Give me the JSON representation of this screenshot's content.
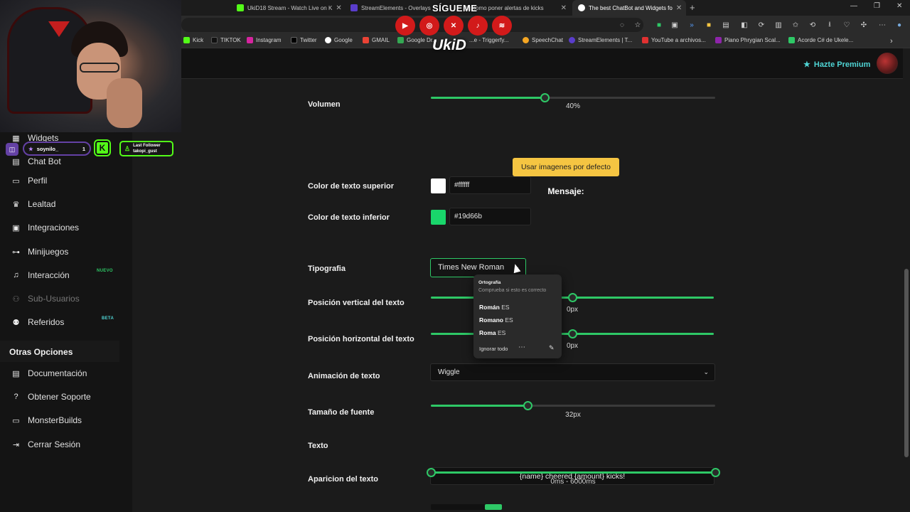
{
  "tabs": [
    {
      "label": "UkiD18 Stream - Watch Live on K",
      "color": "#53fc18"
    },
    {
      "label": "StreamElements - Overlays",
      "color": "#5a3dcb"
    },
    {
      "label": "(9) como poner alertas de kicks",
      "color": "#e03131"
    },
    {
      "label": "The best ChatBot and Widgets fo",
      "color": "#ffffff"
    }
  ],
  "bookmarks": [
    {
      "label": "Kick",
      "color": "#53fc18"
    },
    {
      "label": "TIKTOK",
      "color": "#222222"
    },
    {
      "label": "Instagram",
      "color": "#d6249f"
    },
    {
      "label": "Twitter",
      "color": "#000000"
    },
    {
      "label": "Google",
      "color": "#4285f4"
    },
    {
      "label": "GMAIL",
      "color": "#ea4335"
    },
    {
      "label": "Google Dr...",
      "color": "#34a853"
    },
    {
      "label": "...e - Triggerfy...",
      "color": "#e03131"
    },
    {
      "label": "SpeechChat",
      "color": "#f5a623"
    },
    {
      "label": "StreamElements | T...",
      "color": "#5a3dcb"
    },
    {
      "label": "YouTube a archivos...",
      "color": "#e03131"
    },
    {
      "label": "Piano Phrygian Scal...",
      "color": "#8e24aa"
    },
    {
      "label": "Acorde C# de Ukele...",
      "color": "#2ec866"
    }
  ],
  "header": {
    "premium": "Hazte Premium"
  },
  "sidebar": {
    "items": [
      {
        "label": "Widgets"
      },
      {
        "label": "Chat Bot"
      },
      {
        "label": "Perfil"
      },
      {
        "label": "Lealtad"
      },
      {
        "label": "Integraciones"
      },
      {
        "label": "Minijuegos"
      },
      {
        "label": "Interacción",
        "badge": "NUEVO"
      },
      {
        "label": "Sub-Usuarios"
      },
      {
        "label": "Referidos",
        "badge": "BETA"
      }
    ],
    "section": "Otras Opciones",
    "other": [
      {
        "label": "Documentación"
      },
      {
        "label": "Obtener Soporte"
      },
      {
        "label": "MonsterBuilds"
      },
      {
        "label": "Cerrar Sesión"
      }
    ]
  },
  "form": {
    "volume": {
      "label": "Volumen",
      "value": "40%",
      "fraction": 0.4
    },
    "default_images_button": "Usar imagenes por defecto",
    "message_heading": "Mensaje:",
    "top_color": {
      "label": "Color de texto superior",
      "value": "#ffffff",
      "swatch": "#ffffff"
    },
    "bottom_color": {
      "label": "Color de texto inferior",
      "value": "#19d66b",
      "swatch": "#19d66b"
    },
    "font": {
      "label": "Tipografia",
      "value": "Times New Roman"
    },
    "vpos": {
      "label": "Posición vertical del texto",
      "value": "0px",
      "fraction": 0.5
    },
    "hpos": {
      "label": "Posición horizontal del texto",
      "value": "0px",
      "fraction": 0.5
    },
    "animation": {
      "label": "Animación de texto",
      "value": "Wiggle"
    },
    "font_size": {
      "label": "Tamaño de fuente",
      "value": "32px",
      "fraction": 0.34
    },
    "text": {
      "label": "Texto",
      "value": "{name} cheered {amount} kicks!"
    },
    "appearance": {
      "label": "Aparicion del texto",
      "value": "0ms - 6000ms",
      "from": 0,
      "to": 1
    }
  },
  "spellcheck": {
    "title": "Ortografía",
    "subtitle": "Comprueba si esto es correcto",
    "options": [
      {
        "word": "Román",
        "lang": "ES"
      },
      {
        "word": "Romano",
        "lang": "ES"
      },
      {
        "word": "Roma",
        "lang": "ES"
      }
    ],
    "ignore": "Ignorar todo"
  },
  "overlay": {
    "sigueme": "SÍGUEME",
    "brand": "UkiD",
    "username": "soynilo_",
    "count": "1",
    "last_follower_title": "Last Follower",
    "last_follower_name": "takopi_gust"
  }
}
